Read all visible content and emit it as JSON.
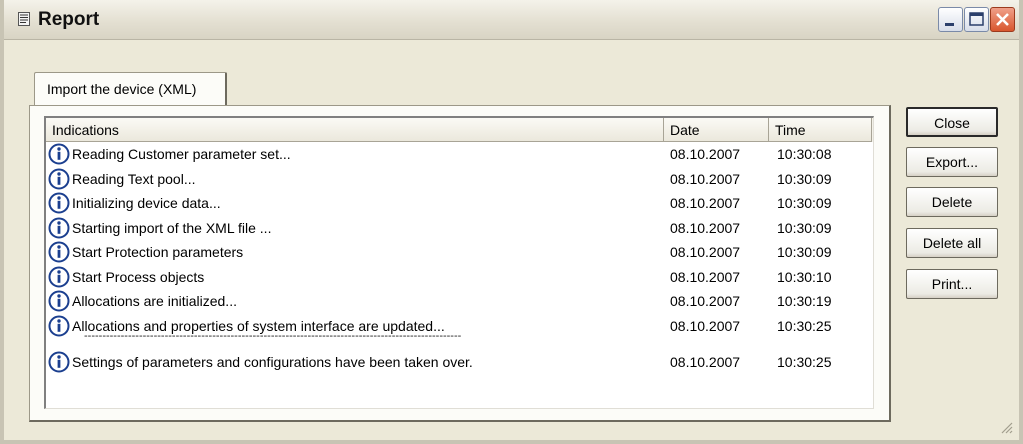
{
  "window": {
    "title": "Report",
    "title_icon": "document-icon",
    "controls": [
      "minimize-icon",
      "maximize-icon",
      "close-icon"
    ]
  },
  "tab": {
    "label": "Import the device (XML)"
  },
  "list": {
    "columns": [
      "Indications",
      "Date",
      "Time"
    ],
    "rows": [
      {
        "icon": "info-icon",
        "indication": "Reading Customer parameter set...",
        "date": "08.10.2007",
        "time": "10:30:08"
      },
      {
        "icon": "info-icon",
        "indication": "Reading Text pool...",
        "date": "08.10.2007",
        "time": "10:30:09"
      },
      {
        "icon": "info-icon",
        "indication": "Initializing device data...",
        "date": "08.10.2007",
        "time": "10:30:09"
      },
      {
        "icon": "info-icon",
        "indication": "Starting import of the XML file ...",
        "date": "08.10.2007",
        "time": "10:30:09"
      },
      {
        "icon": "info-icon",
        "indication": "Start Protection parameters",
        "date": "08.10.2007",
        "time": "10:30:09"
      },
      {
        "icon": "info-icon",
        "indication": "Start Process objects",
        "date": "08.10.2007",
        "time": "10:30:10"
      },
      {
        "icon": "info-icon",
        "indication": "Allocations are initialized...",
        "date": "08.10.2007",
        "time": "10:30:19"
      },
      {
        "icon": "info-icon",
        "indication": "Allocations and properties of system interface are updated...",
        "date": "08.10.2007",
        "time": "10:30:25"
      }
    ],
    "separator": "-------------------------------------------------------------------------------------------------------",
    "last_row": {
      "icon": "info-icon",
      "indication": "Settings of parameters and configurations have been taken over.",
      "date": "08.10.2007",
      "time": "10:30:25"
    }
  },
  "buttons": {
    "close": "Close",
    "export": "Export...",
    "delete": "Delete",
    "delete_all": "Delete all",
    "print": "Print..."
  },
  "colors": {
    "window_bg": "#ece9d8",
    "close_button": "#d9562e",
    "info_icon_blue": "#1b3f8f"
  }
}
